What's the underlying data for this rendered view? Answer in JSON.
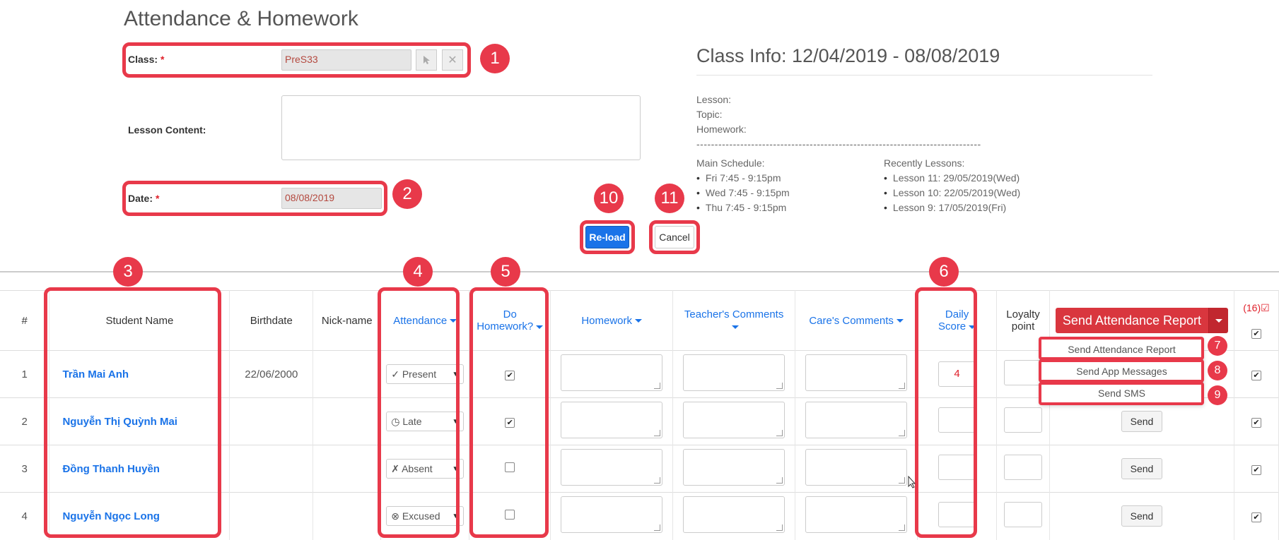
{
  "page": {
    "title": "Attendance & Homework"
  },
  "form": {
    "class_label": "Class:",
    "class_value": "PreS33",
    "lesson_content_label": "Lesson Content:",
    "date_label": "Date:",
    "date_value": "08/08/2019",
    "required_mark": "*"
  },
  "class_info": {
    "title": "Class Info: 12/04/2019 - 08/08/2019",
    "lesson_label": "Lesson:",
    "topic_label": "Topic:",
    "homework_label": "Homework:",
    "separator": "------------------------------------------------------------------------------",
    "main_schedule_label": "Main Schedule:",
    "main_schedule": [
      "Fri 7:45 - 9:15pm",
      "Wed 7:45 - 9:15pm",
      "Thu 7:45 - 9:15pm"
    ],
    "recent_label": "Recently Lessons:",
    "recent": [
      "Lesson 11: 29/05/2019(Wed)",
      "Lesson 10: 22/05/2019(Wed)",
      "Lesson 9: 17/05/2019(Fri)"
    ]
  },
  "buttons": {
    "reload": "Re-load",
    "cancel": "Cancel"
  },
  "table": {
    "headers": {
      "num": "#",
      "student_name": "Student Name",
      "birthdate": "Birthdate",
      "nickname": "Nick-name",
      "attendance": "Attendance",
      "do_homework_1": "Do",
      "do_homework_2": "Homework?",
      "homework": "Homework",
      "teacher_comments": "Teacher's Comments",
      "care_comments": "Care's Comments",
      "daily_score_1": "Daily",
      "daily_score_2": "Score",
      "loyalty_1": "Loyalty",
      "loyalty_2": "point",
      "send_report": "Send Attendance Report",
      "count": "(16)☑"
    },
    "rows": [
      {
        "num": "1",
        "name": "Trần Mai Anh",
        "birthdate": "22/06/2000",
        "attendance": "✓ Present",
        "homework_done": true,
        "score": "4"
      },
      {
        "num": "2",
        "name": "Nguyễn Thị Quỳnh Mai",
        "birthdate": "",
        "attendance": "◷ Late",
        "homework_done": true,
        "score": ""
      },
      {
        "num": "3",
        "name": "Đồng Thanh Huyền",
        "birthdate": "",
        "attendance": "✗ Absent",
        "homework_done": false,
        "score": ""
      },
      {
        "num": "4",
        "name": "Nguyễn Ngọc Long",
        "birthdate": "",
        "attendance": "⊗ Excused",
        "homework_done": false,
        "score": ""
      }
    ],
    "send_label": "Send"
  },
  "dropdown_menu": [
    "Send Attendance Report",
    "Send App Messages",
    "Send SMS"
  ],
  "annotations": [
    "1",
    "2",
    "3",
    "4",
    "5",
    "6",
    "7",
    "8",
    "9",
    "10",
    "11"
  ],
  "colors": {
    "highlight": "#e8394a",
    "primary": "#1a73e8",
    "danger": "#d9363e"
  }
}
